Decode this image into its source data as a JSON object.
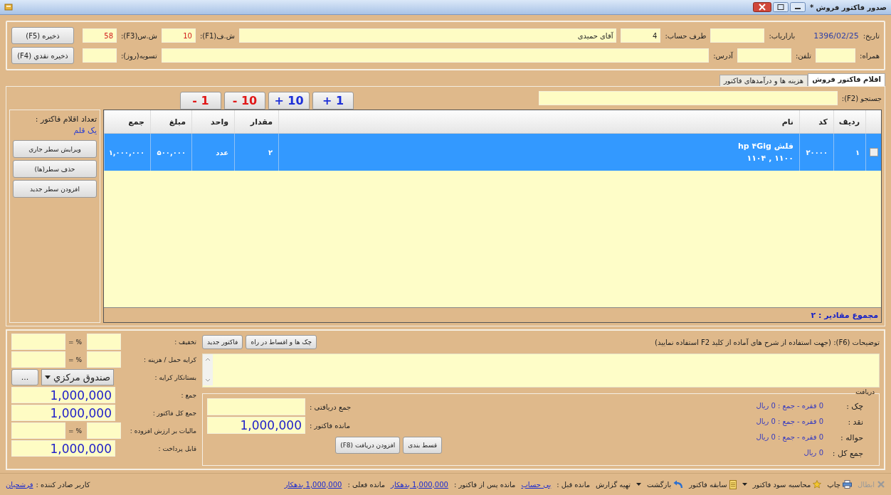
{
  "window": {
    "title": "صدور فاکتور فروش *"
  },
  "header": {
    "row_1": [
      {
        "kind": "date",
        "label": "تاریخ:",
        "value": "1396/02/25"
      },
      {
        "kind": "field",
        "label": "بازاریاب:"
      },
      {
        "kind": "short",
        "label": "طرف حساب:",
        "value": "4"
      },
      {
        "kind": "wide",
        "value": "آقای حمیدی"
      },
      {
        "kind": "counter",
        "label": "ش.ف(F1):",
        "value": "10"
      },
      {
        "kind": "counter",
        "label": "ش.س(F3):",
        "value": "58"
      }
    ],
    "button_1": "ذخیره (F5)",
    "row_2": [
      {
        "kind": "short",
        "label": "همراه:"
      },
      {
        "kind": "field",
        "label": "تلفن:"
      },
      {
        "kind": "wide",
        "label": "آدرس:"
      },
      {
        "kind": "counter",
        "label": "تسویه(روز):"
      }
    ],
    "button_2": "ذخیره نقدي (F4)"
  },
  "tabs": [
    {
      "label": "اقلام فاکتور فروش",
      "selected": true
    },
    {
      "label": "هزینه ها و درآمدهای فاکتور",
      "selected": false
    }
  ],
  "search": {
    "label": "جستجو (F2):"
  },
  "step_buttons": [
    {
      "label": "+ 1",
      "kind": "increase"
    },
    {
      "label": "+ 10",
      "kind": "increase"
    },
    {
      "label": "- 10",
      "kind": "decrease"
    },
    {
      "label": "- 1",
      "kind": "decrease"
    }
  ],
  "side_panel": {
    "count_label": "تعداد اقلام فاکتور :",
    "count_value": "یک قلم",
    "buttons": [
      "ویرایش سطر جاري",
      "حذف سطر(ها)",
      "افزودن سطر جدید"
    ]
  },
  "table": {
    "columns": [
      "ردیف",
      "کد",
      "نام",
      "مقدار",
      "واحد",
      "مبلغ",
      "جمع"
    ],
    "rows": [
      {
        "selected": true,
        "checked": false,
        "row": "۱",
        "code": "۲۰۰۰۰",
        "name": "فلش hp ۴Gig",
        "name_detail": "۱۱۰۰ , ۱۱۰۴",
        "quantity": "۲",
        "unit": "عدد",
        "price": "۵۰۰,۰۰۰",
        "total": "۱,۰۰۰,۰۰۰"
      }
    ],
    "footer": "مجموع مقادیر : ۲"
  },
  "notes": {
    "label": "توضیحات (F6): (جهت استفاده از شرح های آماده از کلید F2 استفاده نمایید)",
    "buttons": [
      "چک ها و اقساط در راه",
      "فاکتور جدید"
    ]
  },
  "receipts": {
    "title": "دریافت",
    "lines": [
      {
        "label": "چک :",
        "value": "0 فقره  -  جمع : 0 ریال"
      },
      {
        "label": "نقد :",
        "value": "0 فقره  -  جمع : 0 ریال"
      },
      {
        "label": "حواله :",
        "value": "0 فقره  -  جمع : 0 ریال"
      },
      {
        "label": "جمع کل :",
        "value": "0 ریال"
      }
    ],
    "fields": [
      {
        "label": "جمع دریافتی :"
      },
      {
        "label": "مانده فاکتور :",
        "value": "1,000,000"
      }
    ],
    "buttons": [
      "قسط بندی",
      "افزودن دریافت (F8)"
    ]
  },
  "totals": [
    {
      "kind": "percent",
      "label": "تخفیف :",
      "sign": "= %"
    },
    {
      "kind": "percent",
      "label": "کرایه حمل / هزینه :",
      "sign": "= %"
    },
    {
      "kind": "select",
      "label": "بستانکار کرایه :",
      "value": "صندوق مرکزي",
      "button": "..."
    },
    {
      "kind": "amount",
      "label": "جمع :",
      "value": "1,000,000"
    },
    {
      "kind": "amount",
      "label": "جمع کل فاکتور :",
      "value": "1,000,000"
    },
    {
      "kind": "percent",
      "label": "مالیات بر ارزش افزوده :",
      "sign": "= %"
    },
    {
      "kind": "amount",
      "label": "قابل پرداخت :",
      "value": "1,000,000"
    }
  ],
  "toolbar": {
    "cancel": {
      "label": "ابطال",
      "disabled": true
    },
    "print": {
      "label": "چاپ",
      "disabled": false
    },
    "profit": {
      "label": "محاسبه سود فاکتور",
      "disabled": false
    },
    "history": {
      "label": "سابقه فاکتور",
      "disabled": false
    },
    "back": {
      "label": "بازگشت",
      "disabled": false
    },
    "report": {
      "label": "تهیه گزارش",
      "disabled": false
    }
  },
  "balances": [
    {
      "label": "مانده قبل :",
      "value": "بی حساب"
    },
    {
      "label": "مانده پس از فاکتور :",
      "value": "1,000,000 بدهکار"
    },
    {
      "label": "مانده فعلی :",
      "value": "1,000,000 بدهکار"
    }
  ],
  "user": {
    "label": "کاربر صادر کننده :",
    "value": "فرشچیان"
  }
}
